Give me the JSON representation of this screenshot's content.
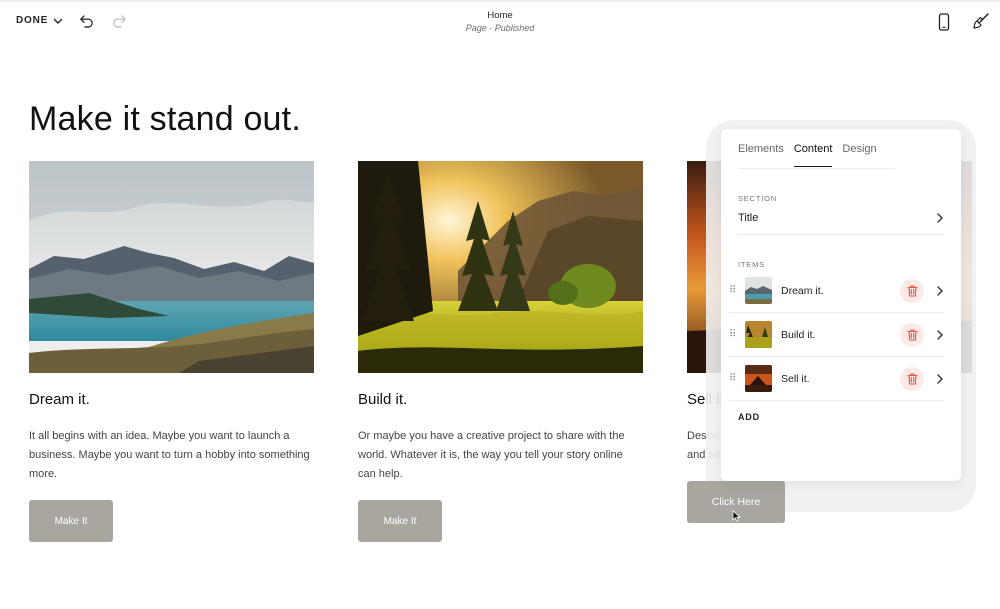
{
  "topbar": {
    "done_label": "DONE",
    "page_title": "Home",
    "page_subtitle": "Page · Published",
    "icons": [
      "chevron-down-icon",
      "undo-icon",
      "redo-icon",
      "mobile-preview-icon",
      "design-brush-icon"
    ]
  },
  "main": {
    "headline": "Make it stand out.",
    "cards": [
      {
        "title": "Dream it.",
        "body": "It all begins with an idea. Maybe you want to launch a business. Maybe you want to turn a hobby into something more.",
        "button": "Make It"
      },
      {
        "title": "Build it.",
        "body": "Or maybe you have a creative project to share with the world. Whatever it is, the way you tell your story online can help.",
        "button": "Make It"
      },
      {
        "title": "Sell it",
        "body_line1": "Descri",
        "body_line2": "and se",
        "button": "Click Here"
      }
    ]
  },
  "panel": {
    "tabs": [
      "Elements",
      "Content",
      "Design"
    ],
    "active_tab": "Content",
    "section_label": "SECTION",
    "section_value": "Title",
    "items_label": "ITEMS",
    "items": [
      {
        "label": "Dream it."
      },
      {
        "label": "Build it."
      },
      {
        "label": "Sell it."
      }
    ],
    "add_label": "ADD"
  },
  "colors": {
    "button_bg": "#a8a69f",
    "trash_bg": "#fbe9e7",
    "trash_icon": "#e0533f"
  }
}
